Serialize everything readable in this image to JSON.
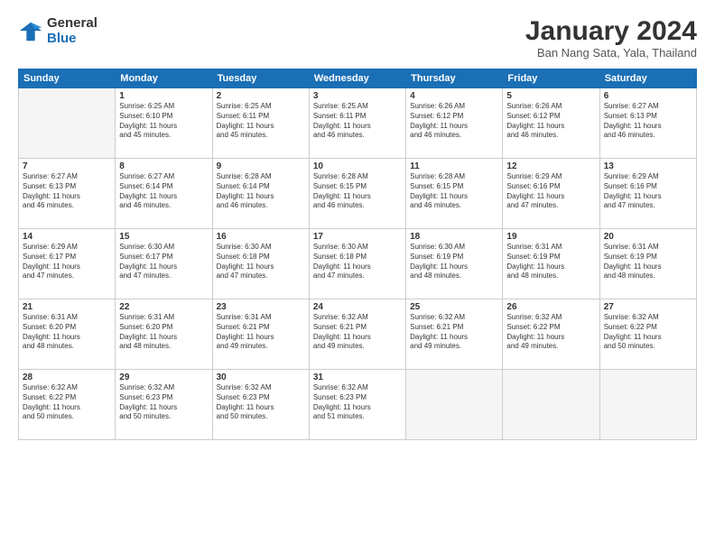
{
  "logo": {
    "general": "General",
    "blue": "Blue"
  },
  "title": "January 2024",
  "subtitle": "Ban Nang Sata, Yala, Thailand",
  "headers": [
    "Sunday",
    "Monday",
    "Tuesday",
    "Wednesday",
    "Thursday",
    "Friday",
    "Saturday"
  ],
  "weeks": [
    [
      {
        "day": "",
        "info": ""
      },
      {
        "day": "1",
        "info": "Sunrise: 6:25 AM\nSunset: 6:10 PM\nDaylight: 11 hours\nand 45 minutes."
      },
      {
        "day": "2",
        "info": "Sunrise: 6:25 AM\nSunset: 6:11 PM\nDaylight: 11 hours\nand 45 minutes."
      },
      {
        "day": "3",
        "info": "Sunrise: 6:25 AM\nSunset: 6:11 PM\nDaylight: 11 hours\nand 46 minutes."
      },
      {
        "day": "4",
        "info": "Sunrise: 6:26 AM\nSunset: 6:12 PM\nDaylight: 11 hours\nand 46 minutes."
      },
      {
        "day": "5",
        "info": "Sunrise: 6:26 AM\nSunset: 6:12 PM\nDaylight: 11 hours\nand 46 minutes."
      },
      {
        "day": "6",
        "info": "Sunrise: 6:27 AM\nSunset: 6:13 PM\nDaylight: 11 hours\nand 46 minutes."
      }
    ],
    [
      {
        "day": "7",
        "info": "Sunrise: 6:27 AM\nSunset: 6:13 PM\nDaylight: 11 hours\nand 46 minutes."
      },
      {
        "day": "8",
        "info": "Sunrise: 6:27 AM\nSunset: 6:14 PM\nDaylight: 11 hours\nand 46 minutes."
      },
      {
        "day": "9",
        "info": "Sunrise: 6:28 AM\nSunset: 6:14 PM\nDaylight: 11 hours\nand 46 minutes."
      },
      {
        "day": "10",
        "info": "Sunrise: 6:28 AM\nSunset: 6:15 PM\nDaylight: 11 hours\nand 46 minutes."
      },
      {
        "day": "11",
        "info": "Sunrise: 6:28 AM\nSunset: 6:15 PM\nDaylight: 11 hours\nand 46 minutes."
      },
      {
        "day": "12",
        "info": "Sunrise: 6:29 AM\nSunset: 6:16 PM\nDaylight: 11 hours\nand 47 minutes."
      },
      {
        "day": "13",
        "info": "Sunrise: 6:29 AM\nSunset: 6:16 PM\nDaylight: 11 hours\nand 47 minutes."
      }
    ],
    [
      {
        "day": "14",
        "info": "Sunrise: 6:29 AM\nSunset: 6:17 PM\nDaylight: 11 hours\nand 47 minutes."
      },
      {
        "day": "15",
        "info": "Sunrise: 6:30 AM\nSunset: 6:17 PM\nDaylight: 11 hours\nand 47 minutes."
      },
      {
        "day": "16",
        "info": "Sunrise: 6:30 AM\nSunset: 6:18 PM\nDaylight: 11 hours\nand 47 minutes."
      },
      {
        "day": "17",
        "info": "Sunrise: 6:30 AM\nSunset: 6:18 PM\nDaylight: 11 hours\nand 47 minutes."
      },
      {
        "day": "18",
        "info": "Sunrise: 6:30 AM\nSunset: 6:19 PM\nDaylight: 11 hours\nand 48 minutes."
      },
      {
        "day": "19",
        "info": "Sunrise: 6:31 AM\nSunset: 6:19 PM\nDaylight: 11 hours\nand 48 minutes."
      },
      {
        "day": "20",
        "info": "Sunrise: 6:31 AM\nSunset: 6:19 PM\nDaylight: 11 hours\nand 48 minutes."
      }
    ],
    [
      {
        "day": "21",
        "info": "Sunrise: 6:31 AM\nSunset: 6:20 PM\nDaylight: 11 hours\nand 48 minutes."
      },
      {
        "day": "22",
        "info": "Sunrise: 6:31 AM\nSunset: 6:20 PM\nDaylight: 11 hours\nand 48 minutes."
      },
      {
        "day": "23",
        "info": "Sunrise: 6:31 AM\nSunset: 6:21 PM\nDaylight: 11 hours\nand 49 minutes."
      },
      {
        "day": "24",
        "info": "Sunrise: 6:32 AM\nSunset: 6:21 PM\nDaylight: 11 hours\nand 49 minutes."
      },
      {
        "day": "25",
        "info": "Sunrise: 6:32 AM\nSunset: 6:21 PM\nDaylight: 11 hours\nand 49 minutes."
      },
      {
        "day": "26",
        "info": "Sunrise: 6:32 AM\nSunset: 6:22 PM\nDaylight: 11 hours\nand 49 minutes."
      },
      {
        "day": "27",
        "info": "Sunrise: 6:32 AM\nSunset: 6:22 PM\nDaylight: 11 hours\nand 50 minutes."
      }
    ],
    [
      {
        "day": "28",
        "info": "Sunrise: 6:32 AM\nSunset: 6:22 PM\nDaylight: 11 hours\nand 50 minutes."
      },
      {
        "day": "29",
        "info": "Sunrise: 6:32 AM\nSunset: 6:23 PM\nDaylight: 11 hours\nand 50 minutes."
      },
      {
        "day": "30",
        "info": "Sunrise: 6:32 AM\nSunset: 6:23 PM\nDaylight: 11 hours\nand 50 minutes."
      },
      {
        "day": "31",
        "info": "Sunrise: 6:32 AM\nSunset: 6:23 PM\nDaylight: 11 hours\nand 51 minutes."
      },
      {
        "day": "",
        "info": ""
      },
      {
        "day": "",
        "info": ""
      },
      {
        "day": "",
        "info": ""
      }
    ]
  ]
}
